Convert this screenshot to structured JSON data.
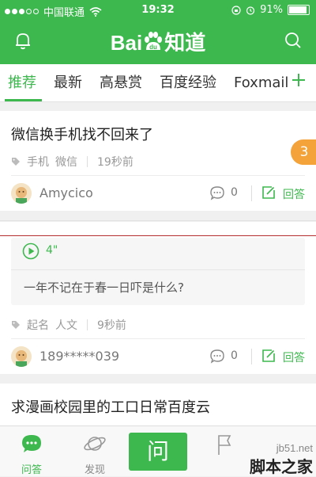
{
  "status_bar": {
    "carrier": "中国联通",
    "time": "19:32",
    "battery": "91%",
    "battery_level": 0.91
  },
  "header": {
    "logo_text": "Bai",
    "logo_suffix": "知道",
    "logo_paw_text": "du"
  },
  "tabs": [
    {
      "label": "推荐",
      "active": true
    },
    {
      "label": "最新"
    },
    {
      "label": "高悬赏"
    },
    {
      "label": "百度经验"
    },
    {
      "label": "Foxmail"
    }
  ],
  "badge": {
    "count": "3"
  },
  "questions": [
    {
      "title": "微信换手机找不回来了",
      "tags": [
        "手机",
        "微信"
      ],
      "time": "19秒前",
      "user": "Amycico",
      "comments": "0",
      "answer_label": "回答"
    },
    {
      "voice_duration": "4\"",
      "voice_text": "一年不记在于春一日吓是什么?",
      "tags": [
        "起名",
        "人文"
      ],
      "time": "9秒前",
      "user": "189*****039",
      "comments": "0",
      "answer_label": "回答"
    },
    {
      "title": "求漫画校园里的工口日常百度云"
    }
  ],
  "tab_bar": {
    "items": [
      {
        "label": "问答",
        "active": true
      },
      {
        "label": "发现"
      }
    ],
    "ask_label": "问"
  },
  "watermark": {
    "url": "jb51.net",
    "name": "脚本之家"
  },
  "colors": {
    "brand": "#3db84e",
    "badge": "#f4a23a"
  }
}
